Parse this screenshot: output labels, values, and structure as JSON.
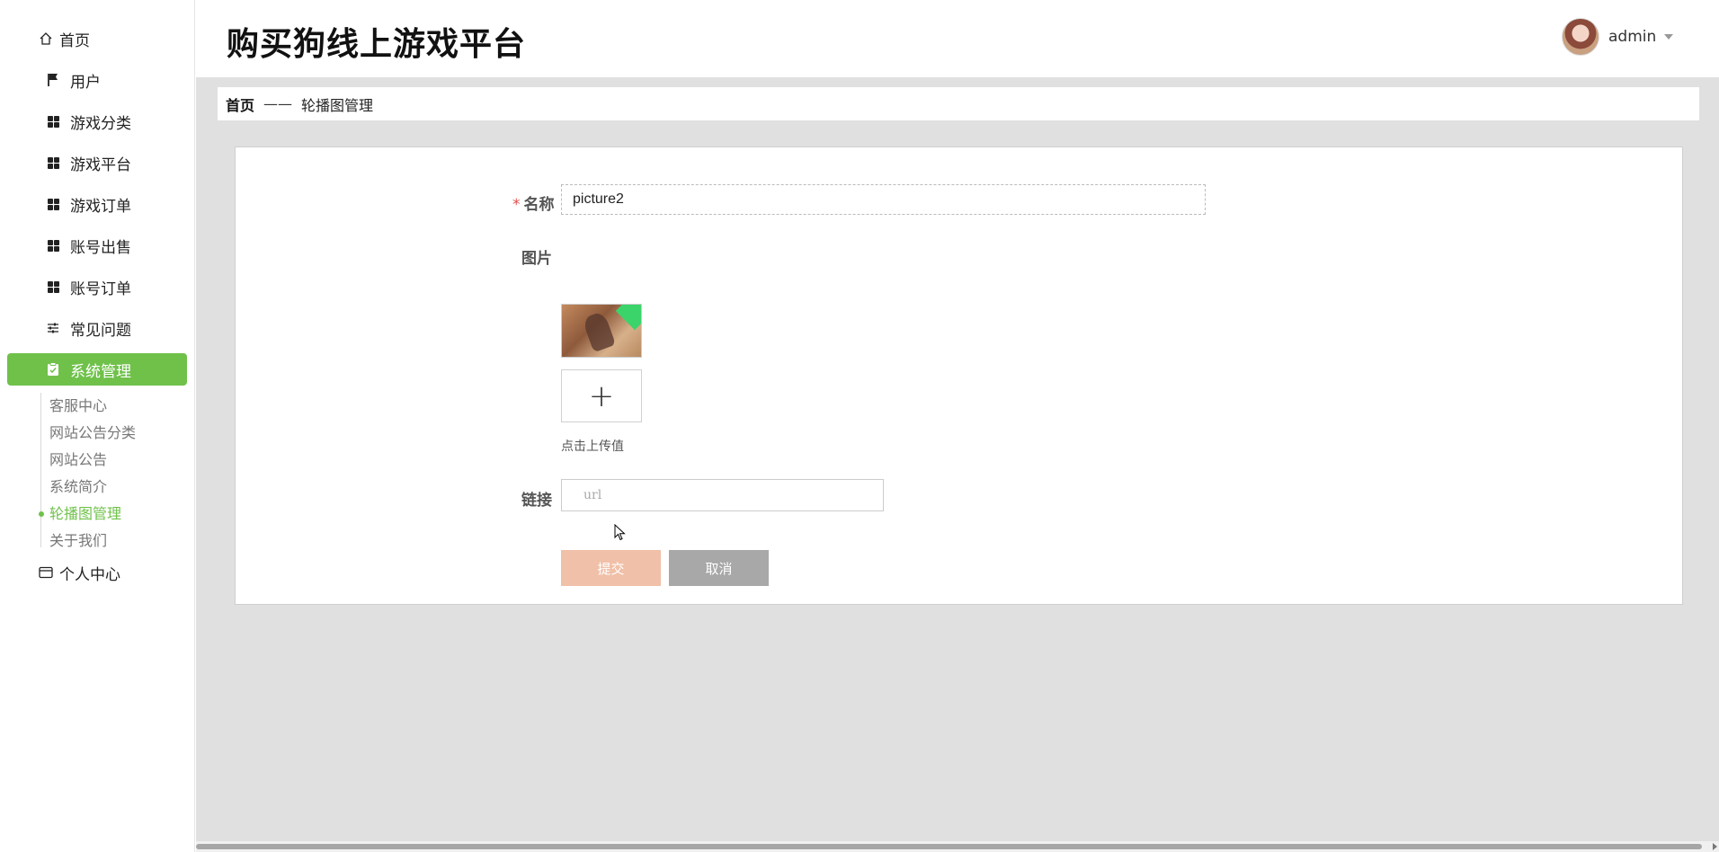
{
  "app": {
    "title": "购买狗线上游戏平台"
  },
  "user": {
    "name": "admin"
  },
  "sidebar": {
    "items": [
      {
        "label": "首页",
        "icon": "home-icon"
      },
      {
        "label": "用户",
        "icon": "flag-icon"
      },
      {
        "label": "游戏分类",
        "icon": "grid-icon"
      },
      {
        "label": "游戏平台",
        "icon": "grid-icon"
      },
      {
        "label": "游戏订单",
        "icon": "grid-icon"
      },
      {
        "label": "账号出售",
        "icon": "grid-icon"
      },
      {
        "label": "账号订单",
        "icon": "grid-icon"
      },
      {
        "label": "常见问题",
        "icon": "sliders-icon"
      },
      {
        "label": "系统管理",
        "icon": "clipboard-icon",
        "active": true
      },
      {
        "label": "个人中心",
        "icon": "wallet-icon"
      }
    ],
    "sub_items": [
      {
        "label": "客服中心"
      },
      {
        "label": "网站公告分类"
      },
      {
        "label": "网站公告"
      },
      {
        "label": "系统简介"
      },
      {
        "label": "轮播图管理",
        "active": true
      },
      {
        "label": "关于我们"
      }
    ],
    "accent_color": "#6fc14a"
  },
  "breadcrumb": {
    "home": "首页",
    "separator": "——",
    "current": "轮播图管理"
  },
  "form": {
    "name_label": "名称",
    "required_mark": "*",
    "name_value": "picture2",
    "image_label": "图片",
    "upload_hint": "点击上传值",
    "upload_plus": "+",
    "link_label": "链接",
    "link_placeholder": "url",
    "submit_label": "提交",
    "cancel_label": "取消"
  }
}
